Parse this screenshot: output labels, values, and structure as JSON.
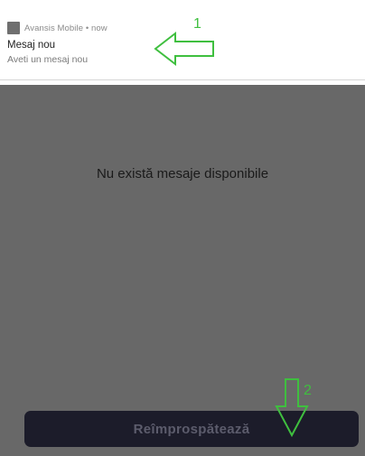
{
  "notification": {
    "app_name": "Avansis Mobile",
    "separator": "•",
    "time": "now",
    "meta": "Avansis Mobile • now",
    "title": "Mesaj nou",
    "body": "Aveti un mesaj nou",
    "icon": "app-icon"
  },
  "main": {
    "empty_message": "Nu există mesaje disponibile",
    "refresh_label": "Reîmprospătează"
  },
  "annotations": {
    "marker_1": "1",
    "marker_2": "2",
    "arrow_color": "#3fbf3f"
  },
  "colors": {
    "overlay": "#686868",
    "button": "#1c1c2a"
  }
}
